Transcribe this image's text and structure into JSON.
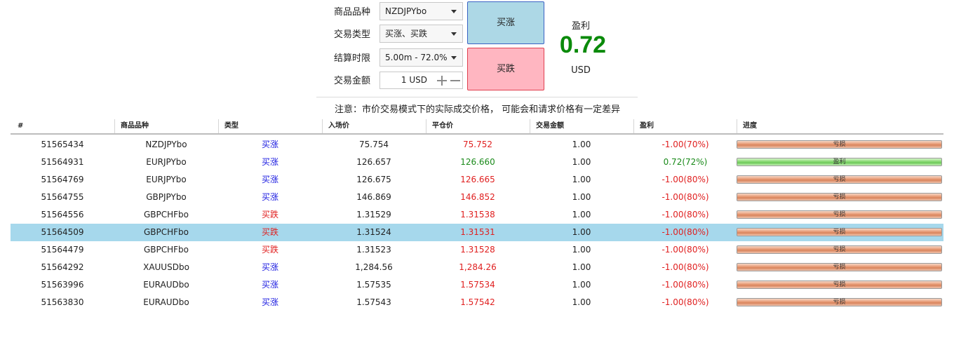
{
  "form": {
    "symbol_label": "商品品种",
    "symbol_value": "NZDJPYbo",
    "type_label": "交易类型",
    "type_value": "买涨、买跌",
    "expiry_label": "结算时限",
    "expiry_value": "5.00m - 72.0%",
    "amount_label": "交易金额",
    "amount_value": "1 USD",
    "buy_up_label": "买涨",
    "buy_down_label": "买跌"
  },
  "profit": {
    "label": "盈利",
    "value": "0.72",
    "unit": "USD"
  },
  "notice": "注意：市价交易模式下的实际成交价格， 可能会和请求价格有一定差异",
  "table": {
    "headers": [
      "#",
      "商品品种",
      "类型",
      "入场价",
      "平仓价",
      "交易金额",
      "盈利",
      "进度"
    ],
    "rows": [
      {
        "id": "51565434",
        "symbol": "NZDJPYbo",
        "type": "买涨",
        "entry": "75.754",
        "close": "75.752",
        "amount": "1.00",
        "pl": "-1.00(70%)",
        "progress": "亏损"
      },
      {
        "id": "51564931",
        "symbol": "EURJPYbo",
        "type": "买涨",
        "entry": "126.657",
        "close": "126.660",
        "amount": "1.00",
        "pl": "0.72(72%)",
        "progress": "盈利"
      },
      {
        "id": "51564769",
        "symbol": "EURJPYbo",
        "type": "买涨",
        "entry": "126.675",
        "close": "126.665",
        "amount": "1.00",
        "pl": "-1.00(80%)",
        "progress": "亏损"
      },
      {
        "id": "51564755",
        "symbol": "GBPJPYbo",
        "type": "买涨",
        "entry": "146.869",
        "close": "146.852",
        "amount": "1.00",
        "pl": "-1.00(80%)",
        "progress": "亏损"
      },
      {
        "id": "51564556",
        "symbol": "GBPCHFbo",
        "type": "买跌",
        "entry": "1.31529",
        "close": "1.31538",
        "amount": "1.00",
        "pl": "-1.00(80%)",
        "progress": "亏损"
      },
      {
        "id": "51564509",
        "symbol": "GBPCHFbo",
        "type": "买跌",
        "entry": "1.31524",
        "close": "1.31531",
        "amount": "1.00",
        "pl": "-1.00(80%)",
        "progress": "亏损"
      },
      {
        "id": "51564479",
        "symbol": "GBPCHFbo",
        "type": "买跌",
        "entry": "1.31523",
        "close": "1.31528",
        "amount": "1.00",
        "pl": "-1.00(80%)",
        "progress": "亏损"
      },
      {
        "id": "51564292",
        "symbol": "XAUUSDbo",
        "type": "买涨",
        "entry": "1,284.56",
        "close": "1,284.26",
        "amount": "1.00",
        "pl": "-1.00(80%)",
        "progress": "亏损"
      },
      {
        "id": "51563996",
        "symbol": "EURAUDbo",
        "type": "买涨",
        "entry": "1.57535",
        "close": "1.57534",
        "amount": "1.00",
        "pl": "-1.00(80%)",
        "progress": "亏损"
      },
      {
        "id": "51563830",
        "symbol": "EURAUDbo",
        "type": "买涨",
        "entry": "1.57543",
        "close": "1.57542",
        "amount": "1.00",
        "pl": "-1.00(80%)",
        "progress": "亏损"
      }
    ]
  },
  "colors": {
    "buy_up": "#1a1ae0",
    "buy_down": "#e02020",
    "profit": "#1a8a1a",
    "loss": "#e02020",
    "selected_row": "#a6d8ec"
  }
}
